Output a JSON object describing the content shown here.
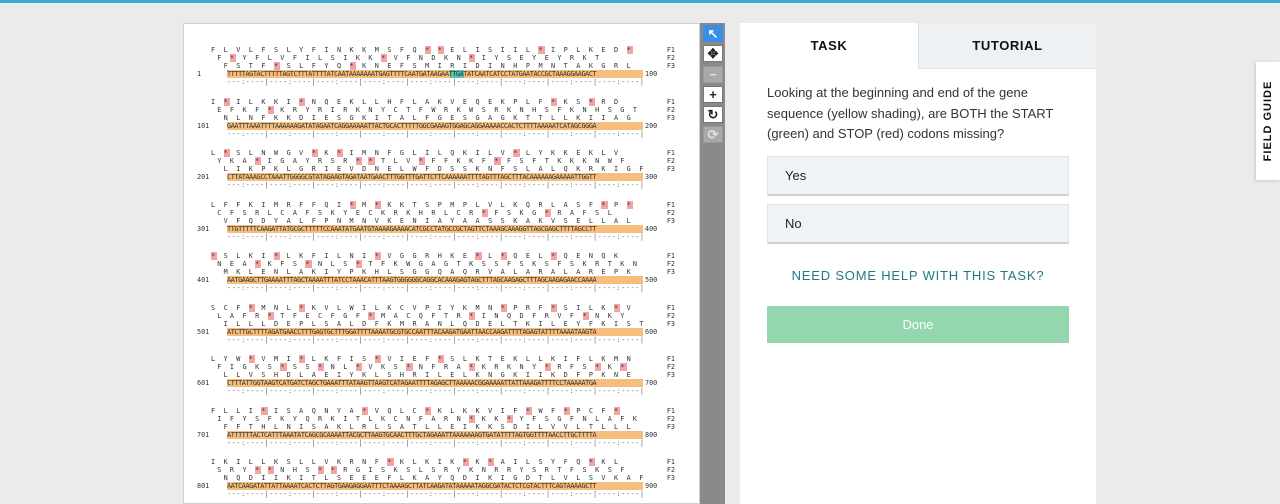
{
  "tabs": {
    "task": "TASK",
    "tutorial": "TUTORIAL"
  },
  "question": "Looking at the beginning and end of the gene sequence (yellow shading), are BOTH the START (green) and STOP (red) codons missing?",
  "answers": [
    "Yes",
    "No"
  ],
  "help_link": "NEED SOME HELP WITH THIS TASK?",
  "done_button": "Done",
  "field_guide": "FIELD GUIDE",
  "toolbar": {
    "select_icon": "pointer-icon",
    "pan_icon": "move-icon",
    "zoom_out_icon": "minus-icon",
    "zoom_in_icon": "plus-icon",
    "rotate_icon": "rotate-icon",
    "reset_icon": "refresh-icon"
  },
  "colors": {
    "gene_shading": "#f6be7c",
    "start_codon": "#58c3b0",
    "stop_codon": "#f4a3a3",
    "done": "#94d6ae",
    "accent": "#3a8ee6"
  },
  "sequence": [
    {
      "f1": "F L V L F S L Y F I N K K M S F Q * * E L I S I I L * I P L K E D *",
      "f2": " F * Y F L V F I L S I K K * V F N D K N * I Y S E Y E Y R K T",
      "f3": "  F S T F * S L F Y Q * K N E F S M I R I D I N H P M N T A K G R L",
      "start": "1",
      "dna": "TTTTTAGTACTTTTTAGTCTTTATTTTATCAATAAAAAAATGAGTTTTCAATGATAAGAATTGATATCAATCATCCTATGAATACCGCTAAAGGAAGACT",
      "end": "100",
      "ruler": "---:----|----:----|----:----|----:----|----:----|----:----|----:----|----:----|----:----|----:----|"
    },
    {
      "f1": "I * I L K K I * N Q E K L L H F L A K V E Q E K P L F * K S * R D",
      "f2": " E F K F * K R Y R I R K N Y C T F W R K W S R K N H S F K N H S G T",
      "f3": "  N L N F K K D I E S G K I T A L F G E S G A G K T T L L K I I A G",
      "start": "101",
      "dna": "GAATTTAAATTTTAAAAAAGATATAGAATCAGGAAAAATTACTGCACTTTTTGGCGAAAGTGGAGCAGGAAAAACCACTCTTTTAAAAATCATAGCGGGA",
      "end": "200",
      "ruler": "---:----|----:----|----:----|----:----|----:----|----:----|----:----|----:----|----:----|----:----|"
    },
    {
      "f1": "L * S L N W G V * K * I M N F G L I L Q K I L V * L Y K K E K L V",
      "f2": " Y K A * I G A Y R S R * * T L V * F F K K F * F S F T K K K N W F",
      "f3": "  L I K P K L G R I E V D N E L W F D S S K N F S L A L Q K R K I G F",
      "start": "201",
      "dna": "CTTATAAAGCCTAAATTGGGGCGTATAGAAGTAGATAATGAACTTTGGTTTGATTCTTCAAAAAATTTTAGTTTAGCTTTACAAAAAAGAAAAATTGGTT",
      "end": "300",
      "ruler": "---:----|----:----|----:----|----:----|----:----|----:----|----:----|----:----|----:----|----:----|"
    },
    {
      "f1": "L F F K I M R F F Q I * M * K K T S P M P L V L K Q R L A S F * P *",
      "f2": " C F S R L C A F S K Y E C K R K H R L C R * F S K G * R A F S L",
      "f3": "  V F Q D Y A L F P N M N V K E N I A Y A A S S K A K V S E L L A L",
      "start": "301",
      "dna": "TTGTTTTTCAAGATTATGCGCTTTTTCCAAATATGAATGTAAAAGAAAACATCGCCTATGCCGCTAGTTCTAAAGCAAAGGTTAGCGAGCTTTTAGCCTT",
      "end": "400",
      "ruler": "---:----|----:----|----:----|----:----|----:----|----:----|----:----|----:----|----:----|----:----|"
    },
    {
      "f1": "* S L K I * L K F I L N I * V G G R H K E * L * Q E L * Q E N Q K",
      "f2": " N E A * K F S * N L S * T F K W G A G T K S S F S K S F S K R T K N",
      "f3": "  M K L E N L A K I Y P K H L S G G Q A Q R V A L A R A L A R E P K",
      "start": "401",
      "dna": "AATGAAGCTTGAAAATTTAGCTAAAATTTATCCTAAACATTTAAGTGGGGGGCAGGCACAAAGAGTAGCTTTAGCAAGAGCTTTAGCAAGAGAACCAAAA",
      "end": "500",
      "ruler": "---:----|----:----|----:----|----:----|----:----|----:----|----:----|----:----|----:----|----:----|"
    },
    {
      "f1": "S C F * M N L * K V L W I L K C V P I Y K M N * P R F * S I L K * V",
      "f2": " L A F R * T F E C F G F * M A C Q F T R * I N Q D F R V F * N K Y",
      "f3": "  I L L L D E P L S A L D F K M R A N L Q D E L T K I L E Y F K I S T",
      "start": "501",
      "dna": "ATCTTGCTTTTAGATGAACCTTTGAGTGCTTTGGATTTTAAAATGCGTGCCAATTTACAAGATGAATTAACCAAGATTTTAGAGTATTTTAAAATAAGTA",
      "end": "600",
      "ruler": "---:----|----:----|----:----|----:----|----:----|----:----|----:----|----:----|----:----|----:----|"
    },
    {
      "f1": "L Y W * V M I * L K F I S * V I E F * S L K T E K L L K I F L K M N",
      "f2": " F I G K S * S S * N L * V K S * N F R A * K R K N Y * R F S * K *",
      "f3": "  L L V S H D L A E I Y K L S H R I L E L K N G K I I K D F P K N E",
      "start": "601",
      "dna": "CTTTATTGGTAAGTCATGATCTAGCTGAAATTTATAAGTTAAGTCATAGAATTTTAGAGCTTAAAAACGGAAAAATTATTAAAGATTTTCCTAAAAATGA",
      "end": "700",
      "ruler": "---:----|----:----|----:----|----:----|----:----|----:----|----:----|----:----|----:----|----:----|"
    },
    {
      "f1": "F L L I * I S A Q N Y A * V Q L C * K L K K V I F * W F * P C F *",
      "f2": " I F Y S F K Y Q R K I T L K C N F A R N * K K * Y F S G F N L A F K",
      "f3": "  F F T H L N I S A K L R L S A T L L E I K K S D I L V V L T L L L",
      "start": "701",
      "dna": "ATTTTTTACTCATTTAAATATCAGCGCAAAATTACGCTTAAGTGCAACTTTGCTAGAAATTAAAAAAAGTGATATTTTAGTGGTTTTAACCTTGCTTTTA",
      "end": "800",
      "ruler": "---:----|----:----|----:----|----:----|----:----|----:----|----:----|----:----|----:----|----:----|"
    },
    {
      "f1": "I K I L L K S L L V K R N F * K L K I K * K * A I L S Y F Q * K L",
      "f2": " S R Y * * N H S * * R G I S K S L S R Y K N R R Y S R T F S K S F",
      "f3": "  N Q D I I K I T L S E E E F L K A Y Q D I K I G D T L V L S V K A F",
      "start": "801",
      "dna": "AATCAAGATATTATTAAAATCACTCTTAGTGAAGAGGAATTTCTAAAAGCTTATCAAGATATAAAAATAGGCGATACTCTCGTACTTTCAGTAAAAGCTT",
      "end": "900",
      "ruler": "---:----|----:----|----:----|----:----|----:----|----:----|----:----|----:----|----:----|----:----|"
    }
  ]
}
